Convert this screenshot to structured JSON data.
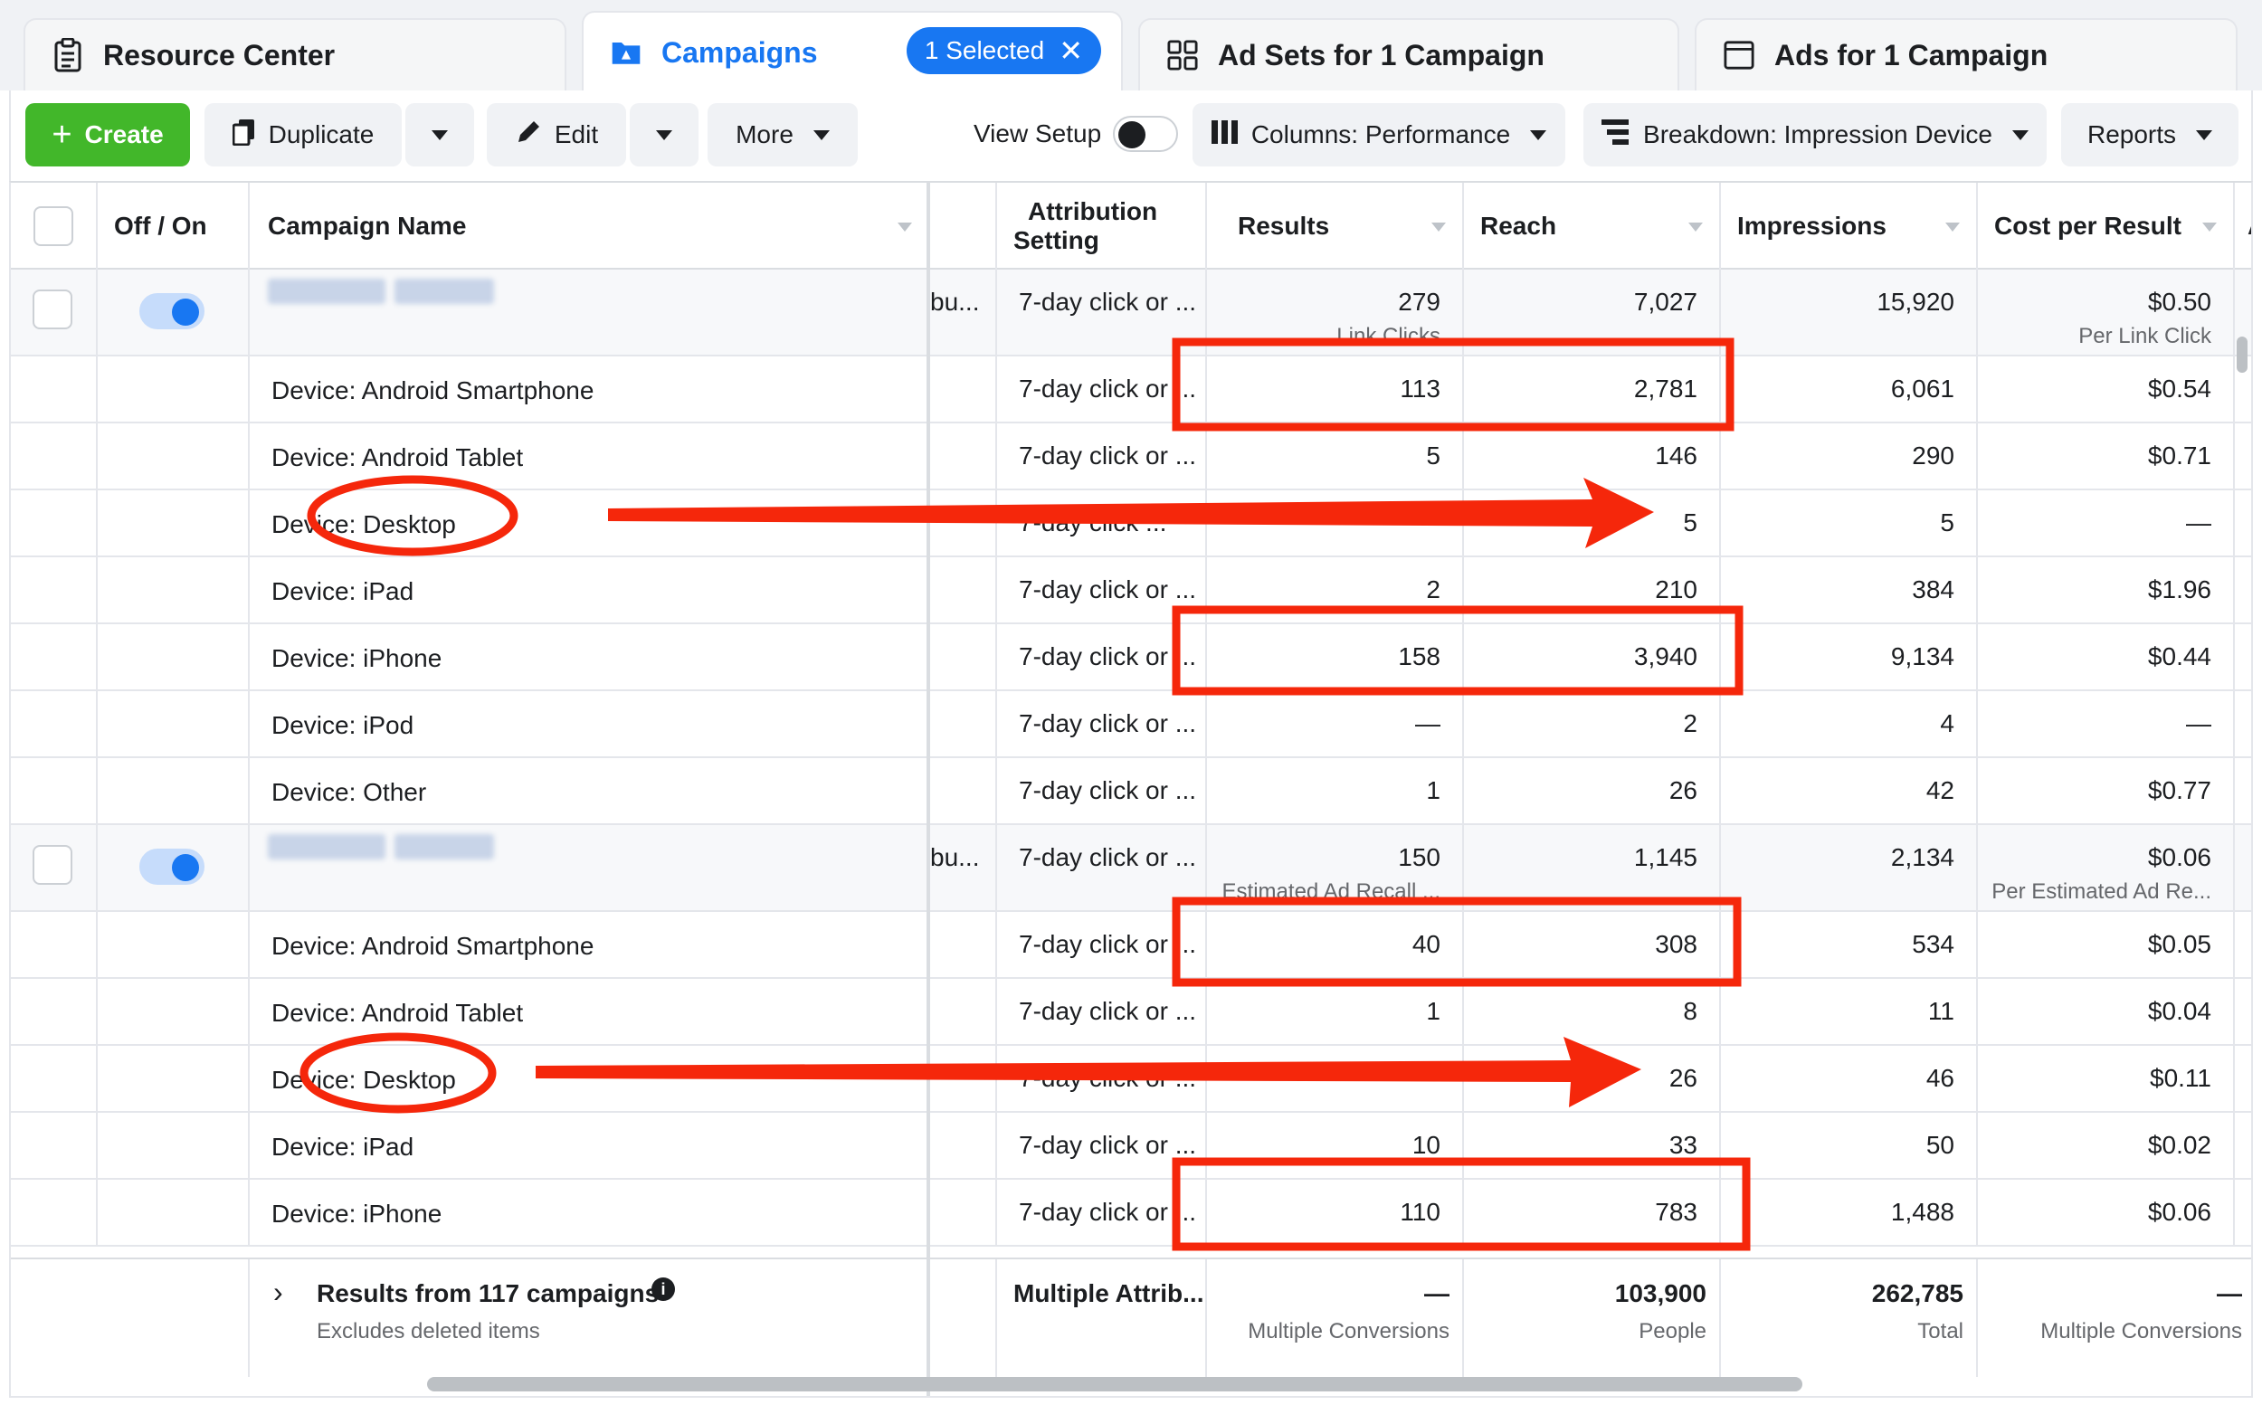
{
  "tabs": [
    {
      "label": "Resource Center",
      "icon": "clipboard-icon"
    },
    {
      "label": "Campaigns",
      "icon": "folder-icon",
      "badge": "1 Selected"
    },
    {
      "label": "Ad Sets for 1 Campaign",
      "icon": "grid-icon"
    },
    {
      "label": "Ads for 1 Campaign",
      "icon": "window-icon"
    }
  ],
  "toolbar": {
    "create": "Create",
    "duplicate": "Duplicate",
    "edit": "Edit",
    "more": "More",
    "view_setup": "View Setup",
    "columns": "Columns: Performance",
    "breakdown": "Breakdown: Impression Device",
    "reports": "Reports"
  },
  "headers": {
    "off_on": "Off / On",
    "campaign_name": "Campaign Name",
    "attribution_1": "Attribution",
    "attribution_2": "Setting",
    "results": "Results",
    "reach": "Reach",
    "impressions": "Impressions",
    "cost_per_result": "Cost per Result",
    "next_col": "A"
  },
  "rows": [
    {
      "type": "parent",
      "name": "",
      "delivery": "bu...",
      "attr": "7-day click or ...",
      "results": "279",
      "results_sub": "Link Clicks",
      "reach": "7,027",
      "impressions": "15,920",
      "cpr": "$0.50",
      "cpr_sub": "Per Link Click"
    },
    {
      "type": "child",
      "name": "Device: Android Smartphone",
      "attr": "7-day click or ...",
      "results": "113",
      "reach": "2,781",
      "impressions": "6,061",
      "cpr": "$0.54"
    },
    {
      "type": "child",
      "name": "Device: Android Tablet",
      "attr": "7-day click or ...",
      "results": "5",
      "reach": "146",
      "impressions": "290",
      "cpr": "$0.71"
    },
    {
      "type": "child",
      "name": "Device: Desktop",
      "attr": "7-day click ...",
      "results": "",
      "reach": "5",
      "impressions": "5",
      "cpr": "—"
    },
    {
      "type": "child",
      "name": "Device: iPad",
      "attr": "7-day click or ...",
      "results": "2",
      "reach": "210",
      "impressions": "384",
      "cpr": "$1.96"
    },
    {
      "type": "child",
      "name": "Device: iPhone",
      "attr": "7-day click or ...",
      "results": "158",
      "reach": "3,940",
      "impressions": "9,134",
      "cpr": "$0.44"
    },
    {
      "type": "child",
      "name": "Device: iPod",
      "attr": "7-day click or ...",
      "results": "—",
      "reach": "2",
      "impressions": "4",
      "cpr": "—"
    },
    {
      "type": "child",
      "name": "Device: Other",
      "attr": "7-day click or ...",
      "results": "1",
      "reach": "26",
      "impressions": "42",
      "cpr": "$0.77"
    },
    {
      "type": "parent",
      "name": "",
      "delivery": "bu...",
      "attr": "7-day click or ...",
      "results": "150",
      "results_sub": "Estimated Ad Recall ...",
      "reach": "1,145",
      "impressions": "2,134",
      "cpr": "$0.06",
      "cpr_sub": "Per Estimated Ad Re..."
    },
    {
      "type": "child",
      "name": "Device: Android Smartphone",
      "attr": "7-day click or ...",
      "results": "40",
      "reach": "308",
      "impressions": "534",
      "cpr": "$0.05"
    },
    {
      "type": "child",
      "name": "Device: Android Tablet",
      "attr": "7-day click or ...",
      "results": "1",
      "reach": "8",
      "impressions": "11",
      "cpr": "$0.04"
    },
    {
      "type": "child",
      "name": "Device: Desktop",
      "attr": "7-day click or ...",
      "results": "",
      "reach": "26",
      "impressions": "46",
      "cpr": "$0.11"
    },
    {
      "type": "child",
      "name": "Device: iPad",
      "attr": "7-day click or ...",
      "results": "10",
      "reach": "33",
      "impressions": "50",
      "cpr": "$0.02"
    },
    {
      "type": "child",
      "name": "Device: iPhone",
      "attr": "7-day click or ...",
      "results": "110",
      "reach": "783",
      "impressions": "1,488",
      "cpr": "$0.06"
    }
  ],
  "footer": {
    "title": "Results from 117 campaigns",
    "subtitle": "Excludes deleted items",
    "attribution": "Multiple Attrib...",
    "results": "—",
    "results_sub": "Multiple Conversions",
    "reach": "103,900",
    "reach_sub": "People",
    "impressions": "262,785",
    "impressions_sub": "Total",
    "cpr": "—",
    "cpr_sub": "Multiple Conversions"
  },
  "colors": {
    "accent": "#1877f2",
    "create": "#42b72a",
    "annotation": "#f5270b"
  }
}
